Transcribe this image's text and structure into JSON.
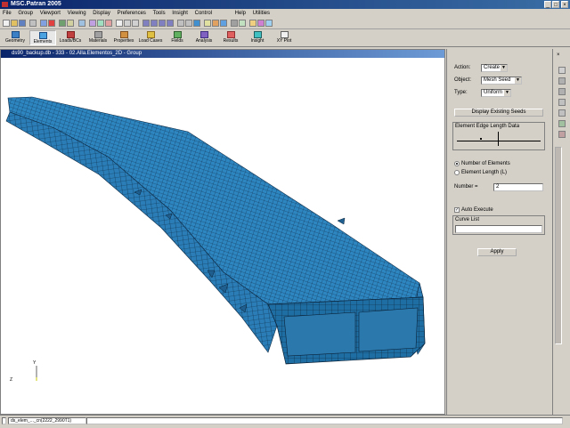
{
  "window": {
    "title": "MSC.Patran 2005",
    "minimize": "_",
    "maximize": "□",
    "close": "×"
  },
  "menu": [
    "File",
    "Group",
    "Viewport",
    "Viewing",
    "Display",
    "Preferences",
    "Tools",
    "Insight",
    "Control",
    "Help",
    "Utilities"
  ],
  "apps": [
    {
      "label": "Geometry",
      "icon": "geometry-icon"
    },
    {
      "label": "Elements",
      "icon": "elements-icon"
    },
    {
      "label": "Loads/BCs",
      "icon": "loads-icon"
    },
    {
      "label": "Materials",
      "icon": "materials-icon"
    },
    {
      "label": "Properties",
      "icon": "properties-icon"
    },
    {
      "label": "Load Cases",
      "icon": "load-cases-icon"
    },
    {
      "label": "Fields",
      "icon": "fields-icon"
    },
    {
      "label": "Analysis",
      "icon": "analysis-icon"
    },
    {
      "label": "Results",
      "icon": "results-icon"
    },
    {
      "label": "Insight",
      "icon": "insight-icon"
    },
    {
      "label": "XY Plot",
      "icon": "xy-plot-icon"
    }
  ],
  "viewport": {
    "title": "ds90_backup.db - 333 - 02.Alla.Elementos_2D - Group",
    "mesh_color": "#2e86c1",
    "edge_color": "#0d2a45"
  },
  "panel": {
    "action_label": "Action:",
    "action_value": "Create",
    "object_label": "Object:",
    "object_value": "Mesh Seed",
    "type_label": "Type:",
    "type_value": "Uniform",
    "display_existing": "Display Existing Seeds",
    "edge_group_label": "Element Edge Length Data",
    "opt_num_elems": "Number of Elements",
    "opt_elem_length": "Element Length (L)",
    "number_label": "Number =",
    "number_value": "2",
    "auto_execute": "Auto Execute",
    "curve_list_label": "Curve List",
    "curve_list_value": "",
    "apply": "Apply"
  },
  "status": {
    "text": "ds_elem_..._cn(2222_2990T1)"
  }
}
